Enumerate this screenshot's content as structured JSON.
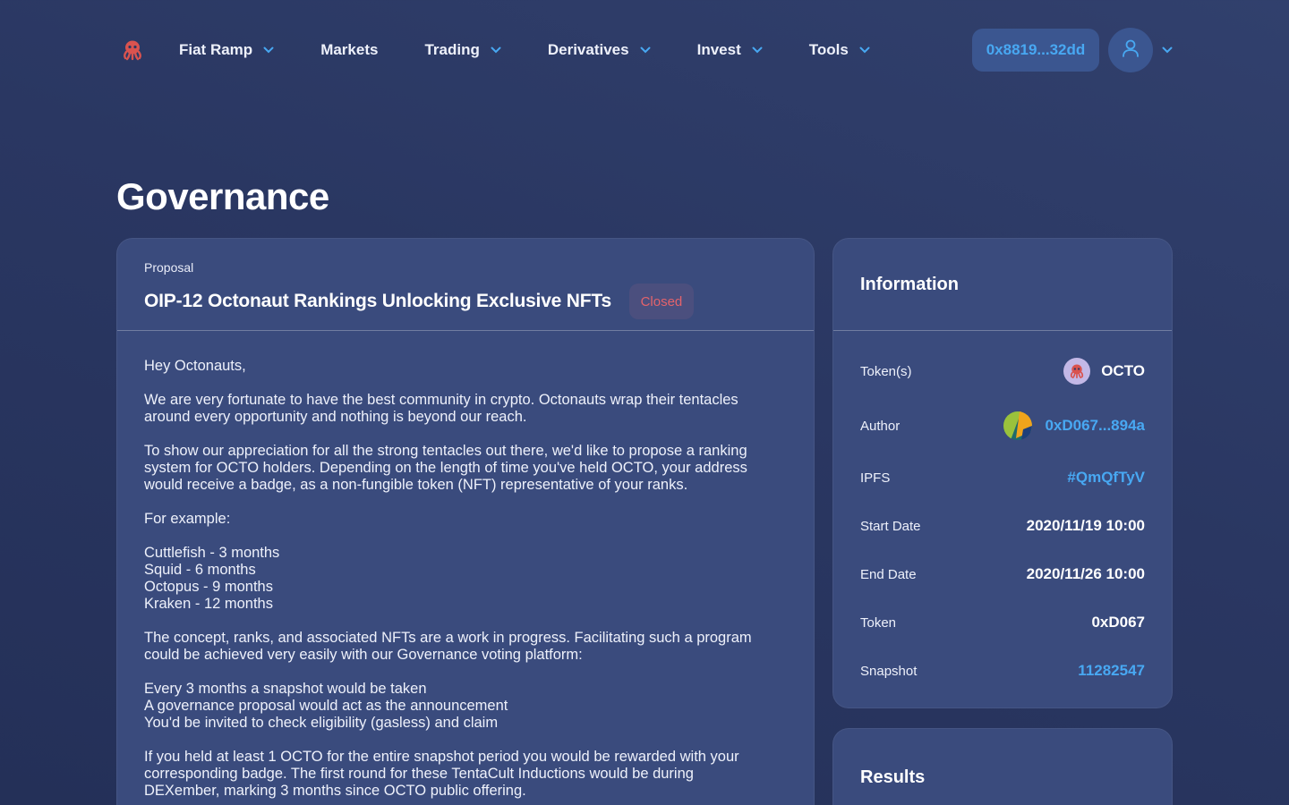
{
  "nav": {
    "items": [
      {
        "label": "Fiat Ramp",
        "dropdown": true
      },
      {
        "label": "Markets",
        "dropdown": false
      },
      {
        "label": "Trading",
        "dropdown": true
      },
      {
        "label": "Derivatives",
        "dropdown": true
      },
      {
        "label": "Invest",
        "dropdown": true
      },
      {
        "label": "Tools",
        "dropdown": true
      }
    ],
    "wallet": "0x8819...32dd"
  },
  "page": {
    "title": "Governance"
  },
  "proposal": {
    "eyebrow": "Proposal",
    "title": "OIP-12 Octonaut Rankings Unlocking Exclusive NFTs",
    "status": "Closed",
    "body": [
      "Hey Octonauts,",
      "We are very fortunate to have the best community in crypto. Octonauts wrap their tentacles\naround every opportunity and nothing is beyond our reach.",
      "To show our appreciation for all the strong tentacles out there, we'd like to propose a ranking\nsystem for OCTO holders. Depending on the length of time you've held OCTO, your address\nwould receive a badge, as a non-fungible token (NFT) representative of your ranks.",
      "For example:",
      "Cuttlefish - 3 months\nSquid - 6 months\nOctopus - 9 months\nKraken - 12 months",
      "The concept, ranks, and associated NFTs are a work in progress. Facilitating such a program\ncould be achieved very easily with our Governance voting platform:",
      "Every 3 months a snapshot would be taken\nA governance proposal would act as the announcement\nYou'd be invited to check eligibility (gasless) and claim",
      "If you held at least 1 OCTO for the entire snapshot period you would be rewarded with your\ncorresponding badge. The first round for these TentaCult Inductions would be during\nDEXember, marking 3 months since OCTO public offering."
    ]
  },
  "information": {
    "title": "Information",
    "rows": [
      {
        "label": "Token(s)",
        "value": "OCTO"
      },
      {
        "label": "Author",
        "value": "0xD067...894a"
      },
      {
        "label": "IPFS",
        "value": "#QmQfTyV"
      },
      {
        "label": "Start Date",
        "value": "2020/11/19 10:00"
      },
      {
        "label": "End Date",
        "value": "2020/11/26 10:00"
      },
      {
        "label": "Token",
        "value": "0xD067"
      },
      {
        "label": "Snapshot",
        "value": "11282547"
      }
    ]
  },
  "results": {
    "title": "Results"
  },
  "colors": {
    "accent": "#48a8f2",
    "closed": "#e4636b",
    "card": "#3a4b7d",
    "background": "#2a3762"
  },
  "icons": [
    "octopus-logo-icon",
    "chevron-down-icon",
    "user-icon",
    "author-identicon-icon"
  ]
}
